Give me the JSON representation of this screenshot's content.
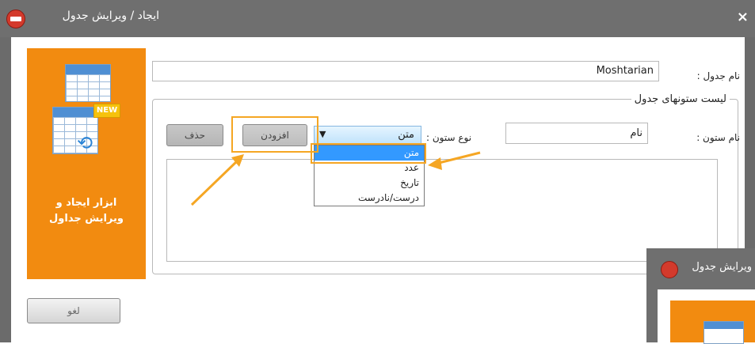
{
  "window": {
    "title": "ایجاد / ویرایش جدول",
    "close": "×"
  },
  "side_panel": {
    "new_badge": "NEW",
    "caption_line1": "ابزار ایجاد و",
    "caption_line2": "ویرایش جداول"
  },
  "form": {
    "table_name_label": "نام جدول :",
    "table_name_value": "Moshtarian",
    "columns_group_title": "لیست ستونهای جدول",
    "column_name_label": "نام ستون :",
    "column_name_value": "نام",
    "column_type_label": "نوع ستون :",
    "column_type_selected": "متن",
    "column_type_options": [
      "متن",
      "عدد",
      "تاریخ",
      "درست/نادرست"
    ],
    "add_button": "افزودن",
    "delete_button": "حذف",
    "cancel_button": "لغو"
  },
  "second_window": {
    "title": "ویرایش جدول"
  },
  "colors": {
    "accent_orange": "#f28b10",
    "highlight": "#f5a623",
    "selection_blue": "#3399ff",
    "titlebar_gray": "#6f6f6f"
  }
}
